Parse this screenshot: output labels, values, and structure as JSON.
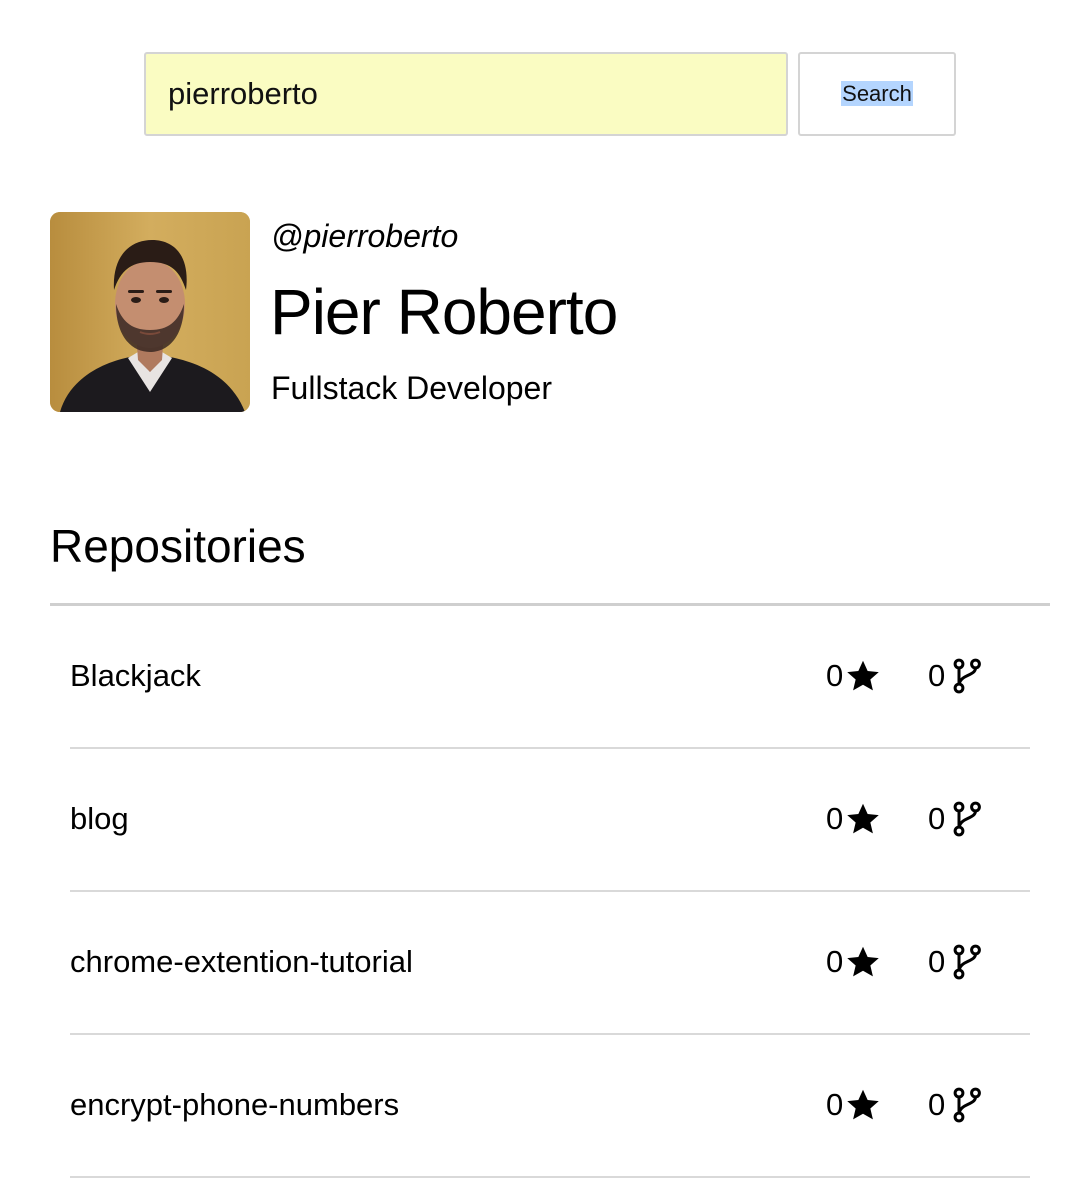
{
  "search": {
    "value": "pierroberto",
    "button_label": "Search"
  },
  "profile": {
    "handle": "@pierroberto",
    "name": "Pier Roberto",
    "bio": "Fullstack Developer",
    "avatar_icon": "user-photo"
  },
  "repositories": {
    "heading": "Repositories",
    "star_icon": "star-icon",
    "fork_icon": "fork-icon",
    "items": [
      {
        "name": "Blackjack",
        "stars": "0",
        "forks": "0"
      },
      {
        "name": "blog",
        "stars": "0",
        "forks": "0"
      },
      {
        "name": "chrome-extention-tutorial",
        "stars": "0",
        "forks": "0"
      },
      {
        "name": "encrypt-phone-numbers",
        "stars": "0",
        "forks": "0"
      }
    ]
  }
}
